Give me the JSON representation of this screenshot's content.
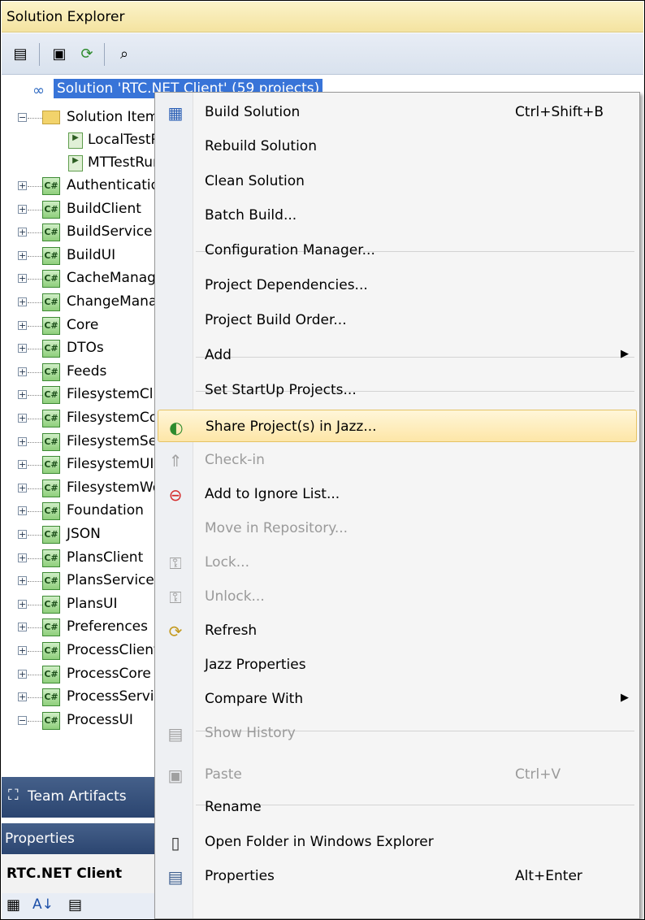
{
  "solution_explorer": {
    "title": "Solution Explorer",
    "solution_label": "Solution 'RTC.NET Client' (59 projects)",
    "solution_items_folder": "Solution Items",
    "solution_files": [
      "LocalTestRun.testrunconfig",
      "MTTestRun.testrunconfig"
    ],
    "projects": [
      "Authentication",
      "BuildClient",
      "BuildService",
      "BuildUI",
      "CacheManager",
      "ChangeManager",
      "Core",
      "DTOs",
      "Feeds",
      "FilesystemClient",
      "FilesystemCore",
      "FilesystemService",
      "FilesystemUI",
      "FilesystemWorkspace",
      "Foundation",
      "JSON",
      "PlansClient",
      "PlansService",
      "PlansUI",
      "Preferences",
      "ProcessClient",
      "ProcessCore",
      "ProcessService",
      "ProcessUI"
    ]
  },
  "team_artifacts": {
    "label": "Team Artifacts"
  },
  "properties": {
    "title": "Properties",
    "object_name": "RTC.NET Client"
  },
  "context_menu": {
    "items": [
      {
        "label": "Build Solution",
        "shortcut": "Ctrl+Shift+B",
        "icon": "build-icon"
      },
      {
        "label": "Rebuild Solution"
      },
      {
        "label": "Clean Solution"
      },
      {
        "label": "Batch Build..."
      },
      {
        "label": "Configuration Manager..."
      },
      {
        "label": "Project Dependencies..."
      },
      {
        "label": "Project Build Order..."
      },
      {
        "label": "Add",
        "submenu": true
      },
      {
        "label": "Set StartUp Projects..."
      },
      {
        "label": "Share Project(s) in Jazz...",
        "icon": "jazz-share-icon",
        "highlighted": true
      },
      {
        "label": "Check-in",
        "disabled": true,
        "icon": "check-in-icon"
      },
      {
        "label": "Add to Ignore List...",
        "icon": "ignore-icon"
      },
      {
        "label": "Move in Repository...",
        "disabled": true
      },
      {
        "label": "Lock...",
        "disabled": true,
        "icon": "lock-icon"
      },
      {
        "label": "Unlock...",
        "disabled": true,
        "icon": "unlock-icon"
      },
      {
        "label": "Refresh",
        "icon": "refresh-icon"
      },
      {
        "label": "Jazz Properties"
      },
      {
        "label": "Compare With",
        "submenu": true
      },
      {
        "label": "Show History",
        "disabled": true,
        "icon": "history-icon"
      },
      {
        "label": "Paste",
        "shortcut": "Ctrl+V",
        "disabled": true,
        "icon": "paste-icon"
      },
      {
        "label": "Rename"
      },
      {
        "label": "Open Folder in Windows Explorer",
        "icon": "folder-open-icon"
      },
      {
        "label": "Properties",
        "shortcut": "Alt+Enter",
        "icon": "properties-icon"
      }
    ]
  }
}
